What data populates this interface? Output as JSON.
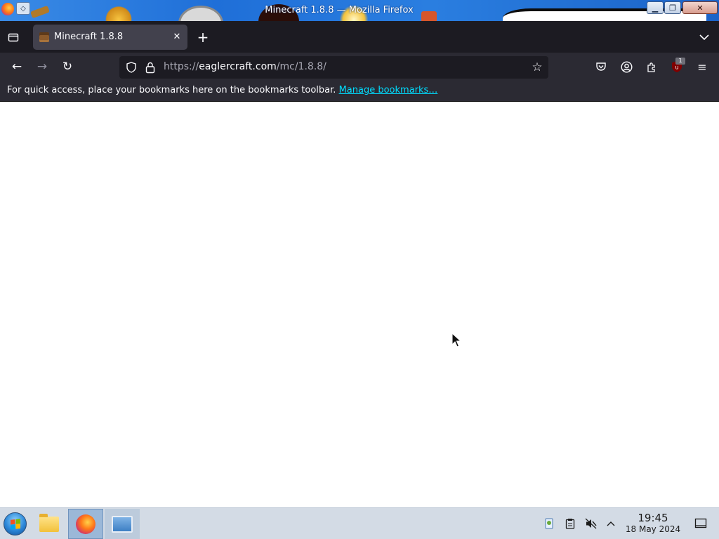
{
  "window": {
    "title": "Minecraft 1.8.8 — Mozilla Firefox",
    "controls": {
      "minimize": "▁",
      "maximize": "❐",
      "close": "✕"
    }
  },
  "tabs": {
    "active": {
      "title": "Minecraft 1.8.8",
      "close": "✕",
      "favicon": "minecraft-chest-icon"
    },
    "new_tab": "+"
  },
  "navigation": {
    "back": "←",
    "forward": "→",
    "reload": "↻",
    "url_prefix": "https://",
    "url_host": "eaglercraft.com",
    "url_path": "/mc/1.8.8/",
    "bookmark_star": "☆",
    "ublock_badge": "1",
    "menu": "≡"
  },
  "bookmarks_toolbar": {
    "message": "For quick access, place your bookmarks here on the bookmarks toolbar.",
    "manage_link": "Manage bookmarks…"
  },
  "taskbar": {
    "apps": [
      "start-menu",
      "file-manager",
      "firefox",
      "system-settings"
    ],
    "clock": {
      "time": "19:45",
      "date": "18 May 2024"
    }
  },
  "colors": {
    "tab_strip": "#1c1b22",
    "toolbar": "#2b2a33",
    "active_tab": "#42414d",
    "link": "#00ddff",
    "taskbar": "#d3dbe5"
  }
}
